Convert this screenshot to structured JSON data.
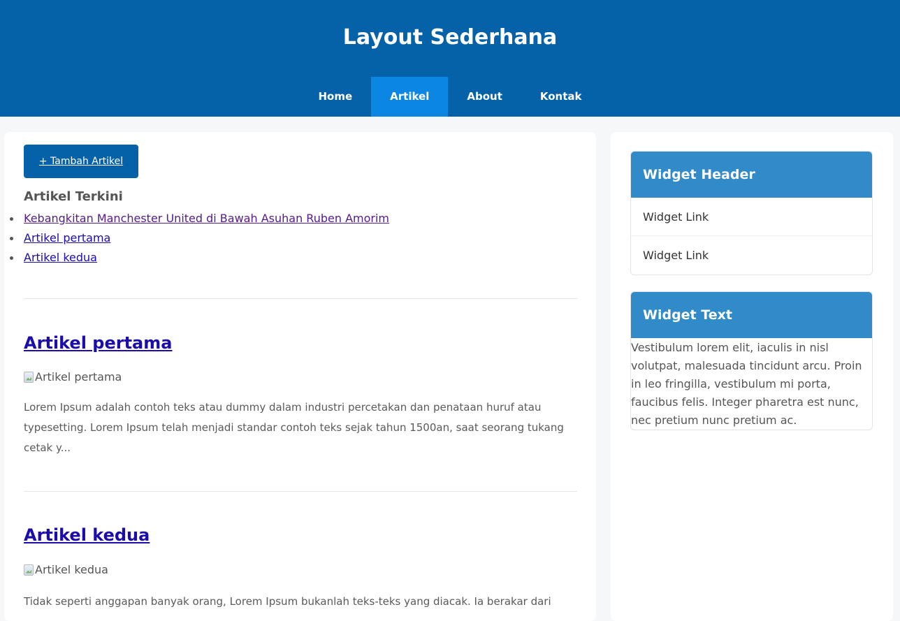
{
  "header": {
    "title": "Layout Sederhana",
    "nav": [
      "Home",
      "Artikel",
      "About",
      "Kontak"
    ],
    "active_nav": "Artikel"
  },
  "main": {
    "add_button": "+ Tambah Artikel",
    "recent_title": "Artikel Terkini",
    "recent": [
      "Kebangkitan Manchester United di Bawah Asuhan Ruben Amorim",
      "Artikel pertama",
      "Artikel kedua"
    ],
    "articles": [
      {
        "title": "Artikel pertama",
        "image_alt": "Artikel pertama",
        "excerpt": "Lorem Ipsum adalah contoh teks atau dummy dalam industri percetakan dan penataan huruf atau typesetting. Lorem Ipsum telah menjadi standar contoh teks sejak tahun 1500an, saat seorang tukang cetak y..."
      },
      {
        "title": "Artikel kedua",
        "image_alt": "Artikel kedua",
        "excerpt": "Tidak seperti anggapan banyak orang, Lorem Ipsum bukanlah teks-teks yang diacak. Ia berakar dari"
      }
    ]
  },
  "sidebar": {
    "widget1": {
      "header": "Widget Header",
      "links": [
        "Widget Link",
        "Widget Link"
      ]
    },
    "widget2": {
      "header": "Widget Text",
      "text": "Vestibulum lorem elit, iaculis in nisl volutpat, malesuada tincidunt arcu. Proin in leo fringilla, vestibulum mi porta, faucibus felis. Integer pharetra est nunc, nec pretium nunc pretium ac."
    }
  },
  "colors": {
    "header_bg": "#0561a8",
    "nav_active": "#0b87e3",
    "widget_header": "#318bc8",
    "link": "#1a0dab",
    "visited_link": "#551a8b"
  }
}
